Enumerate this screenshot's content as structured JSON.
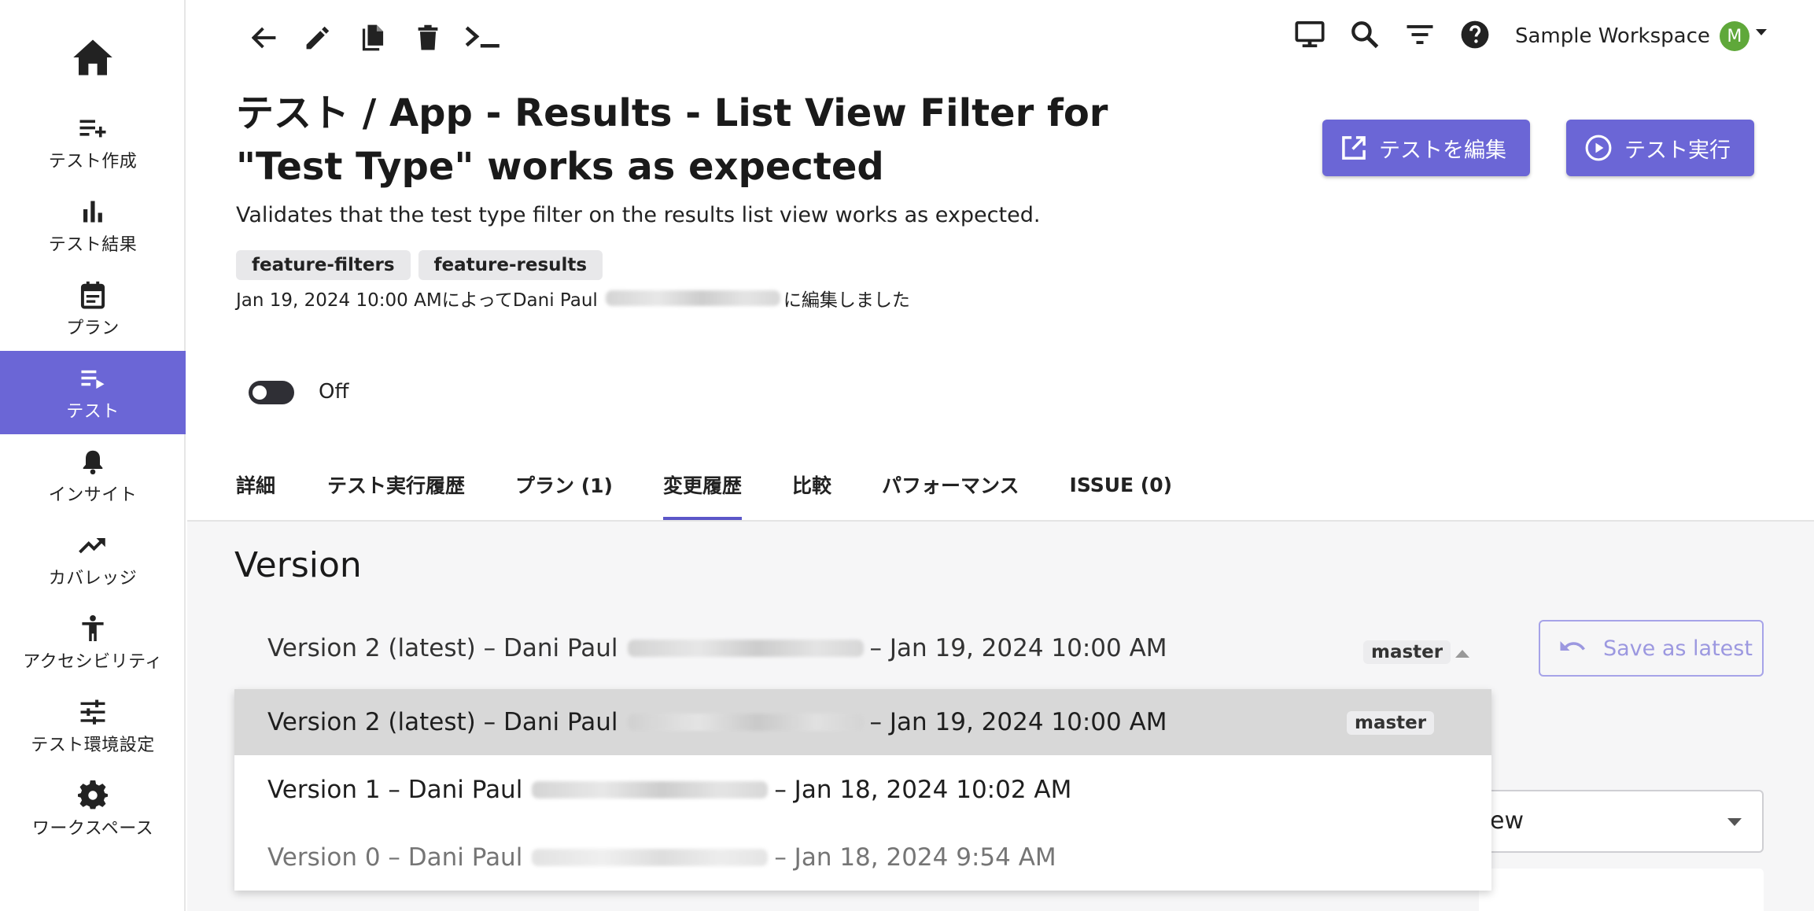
{
  "sidebar": {
    "items": [
      {
        "label": "テスト作成",
        "icon": "playlist-add-icon"
      },
      {
        "label": "テスト結果",
        "icon": "bar-chart-icon"
      },
      {
        "label": "プラン",
        "icon": "calendar-icon"
      },
      {
        "label": "テスト",
        "icon": "playlist-play-icon"
      },
      {
        "label": "インサイト",
        "icon": "bell-icon"
      },
      {
        "label": "カバレッジ",
        "icon": "trending-up-icon"
      },
      {
        "label": "アクセシビリティ",
        "icon": "accessibility-icon"
      },
      {
        "label": "テスト環境設定",
        "icon": "tune-icon"
      },
      {
        "label": "ワークスペース",
        "icon": "gear-icon"
      }
    ]
  },
  "header": {
    "workspace_name": "Sample Workspace",
    "avatar_initial": "M"
  },
  "test": {
    "title": "テスト / App - Results - List View Filter for \"Test Type\" works as expected",
    "description": "Validates that the test type filter on the results list view works as expected.",
    "tags": [
      "feature-filters",
      "feature-results"
    ],
    "edited_prefix": "Jan 19, 2024 10:00 AMによってDani Paul",
    "edited_suffix": "に編集しました"
  },
  "actions": {
    "edit_label": "テストを編集",
    "run_label": "テスト実行"
  },
  "toggle": {
    "label": "Off",
    "on": false
  },
  "tabs": [
    "詳細",
    "テスト実行履歴",
    "プラン (1)",
    "変更履歴",
    "比較",
    "パフォーマンス",
    "ISSUE (0)"
  ],
  "active_tab": "変更履歴",
  "version": {
    "heading": "Version",
    "selected": {
      "prefix": "Version 2 (latest) – Dani Paul",
      "date": "– Jan 19, 2024 10:00 AM",
      "branch": "master"
    },
    "save_label": "Save as latest",
    "options": [
      {
        "prefix": "Version 2 (latest) – Dani Paul",
        "date": "– Jan 19, 2024 10:00 AM",
        "branch": "master"
      },
      {
        "prefix": "Version 1 – Dani Paul",
        "date": "– Jan 18, 2024 10:02 AM",
        "branch": ""
      },
      {
        "prefix": "Version 0 – Dani Paul",
        "date": "– Jan 18, 2024 9:54 AM",
        "branch": ""
      }
    ],
    "background_select_partial": "ew"
  },
  "colors": {
    "accent": "#6b66d6",
    "tab_underline": "#5b56c8",
    "avatar": "#5fa83a"
  }
}
